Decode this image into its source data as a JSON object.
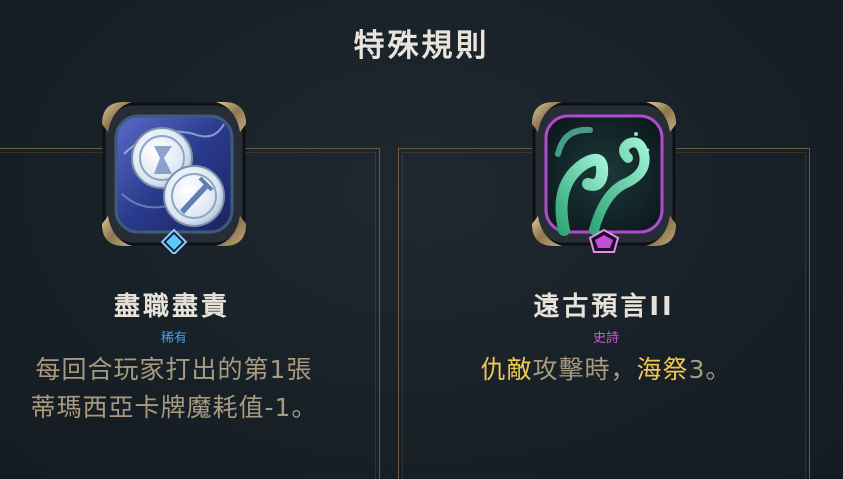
{
  "header": {
    "title": "特殊規則"
  },
  "cards": [
    {
      "name": "盡職盡責",
      "rarity": "稀有",
      "description_line1": "每回合玩家打出的第1張",
      "description_line2": "蒂瑪西亞卡牌魔耗值-1。",
      "icon": "coins-with-sword-icon",
      "rarity_gem": "blue-diamond-gem-icon",
      "rarity_color": "#4a9ee8"
    },
    {
      "name": "遠古預言II",
      "rarity": "史詩",
      "description_parts": [
        "仇敵",
        "攻擊時，",
        "海祭",
        "3。"
      ],
      "icon": "sea-tentacle-icon",
      "rarity_gem": "purple-pentagon-gem-icon",
      "rarity_color": "#d35ad8"
    }
  ],
  "colors": {
    "background": "#1a2128",
    "border_gold": "#6b5a3e",
    "keyword_gold": "#f0c850",
    "description_text": "#a89a7e"
  }
}
